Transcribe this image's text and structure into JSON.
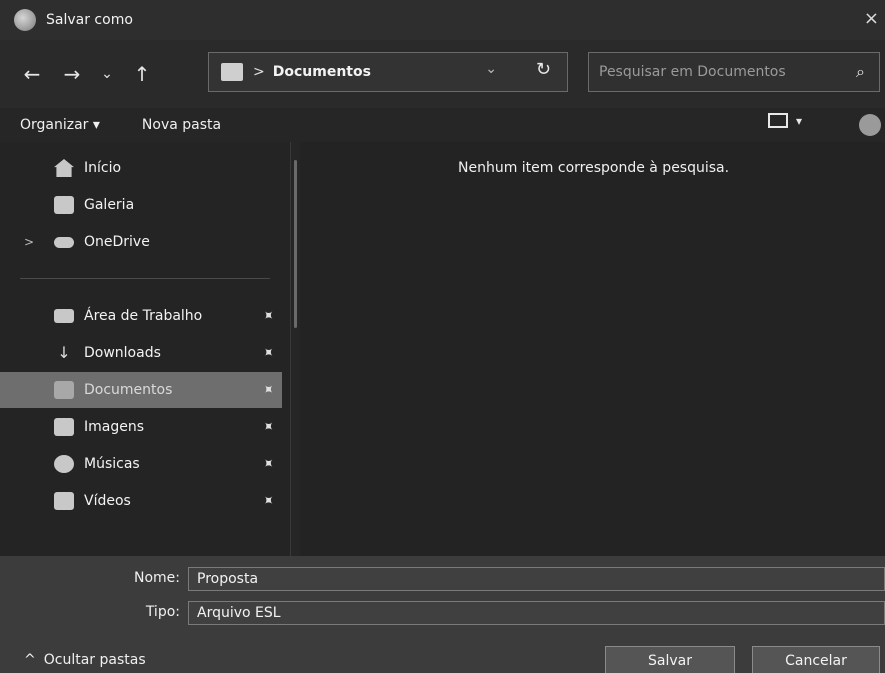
{
  "window": {
    "title": "Salvar como",
    "close_glyph": "×"
  },
  "nav": {
    "back_icon": "←",
    "forward_icon": "→",
    "recent_icon": "⌄",
    "up_icon": "↑",
    "breadcrumb_sep": ">",
    "current_folder": "Documentos",
    "refresh_icon": "↻",
    "dropdown_icon": "⌄",
    "search_placeholder": "Pesquisar em Documentos",
    "search_icon": "⌕"
  },
  "commands": {
    "organize": "Organizar ▾",
    "new_folder": "Nova pasta",
    "view_caret": "▾"
  },
  "sidebar": {
    "items": [
      {
        "label": "Início",
        "icon": "home-icon",
        "pinned": false,
        "selected": false
      },
      {
        "label": "Galeria",
        "icon": "gallery-icon",
        "pinned": false,
        "selected": false
      },
      {
        "label": "OneDrive",
        "icon": "cloud-icon",
        "pinned": false,
        "selected": false,
        "expand": ">"
      },
      {
        "label": "Área de Trabalho",
        "icon": "desktop-icon",
        "pinned": true,
        "selected": false
      },
      {
        "label": "Downloads",
        "icon": "download-icon",
        "pinned": true,
        "selected": false
      },
      {
        "label": "Documentos",
        "icon": "documents-icon",
        "pinned": true,
        "selected": true
      },
      {
        "label": "Imagens",
        "icon": "pictures-icon",
        "pinned": true,
        "selected": false
      },
      {
        "label": "Músicas",
        "icon": "music-icon",
        "pinned": true,
        "selected": false
      },
      {
        "label": "Vídeos",
        "icon": "videos-icon",
        "pinned": true,
        "selected": false
      }
    ],
    "pin_glyph": "✦"
  },
  "content": {
    "empty_message": "Nenhum item corresponde à pesquisa."
  },
  "form": {
    "name_label": "Nome:",
    "name_value": "Proposta",
    "type_label": "Tipo:",
    "type_value": "Arquivo ESL"
  },
  "footer": {
    "hide_folders_icon": "^",
    "hide_folders": "Ocultar pastas",
    "save": "Salvar",
    "cancel": "Cancelar"
  }
}
